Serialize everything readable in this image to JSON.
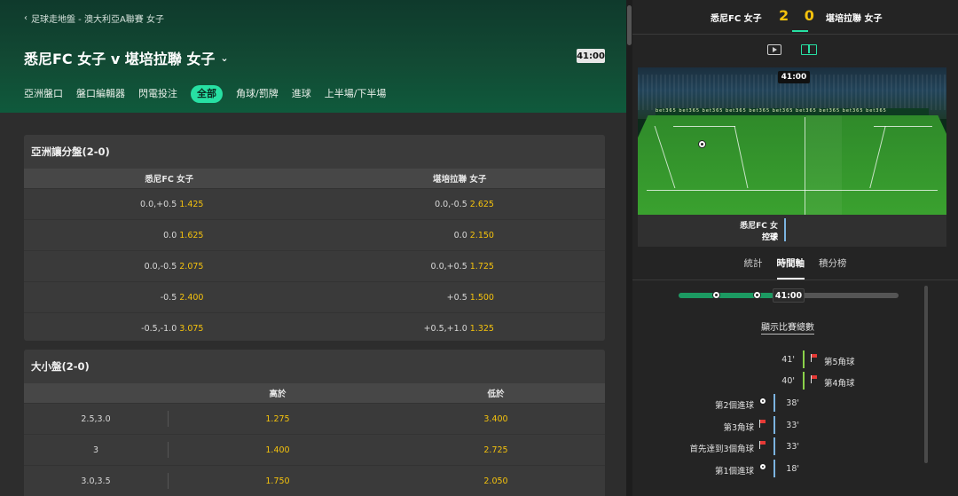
{
  "breadcrumb": "足球走地盤 - 澳大利亞A聯賽 女子",
  "match": {
    "title": "悉尼FC 女子 v 堪培拉聯 女子",
    "clock": "41:00"
  },
  "tabs": [
    "亞洲盤口",
    "盤口編輯器",
    "閃電投注",
    "全部",
    "角球/罰牌",
    "進球",
    "上半場/下半場"
  ],
  "active_tab": "全部",
  "asian_handicap": {
    "title": "亞洲讓分盤(2-0)",
    "home_header": "悉尼FC 女子",
    "away_header": "堪培拉聯 女子",
    "rows": [
      {
        "home_line": "0.0,+0.5",
        "home_price": "1.425",
        "away_line": "0.0,-0.5",
        "away_price": "2.625"
      },
      {
        "home_line": "0.0",
        "home_price": "1.625",
        "away_line": "0.0",
        "away_price": "2.150"
      },
      {
        "home_line": "0.0,-0.5",
        "home_price": "2.075",
        "away_line": "0.0,+0.5",
        "away_price": "1.725"
      },
      {
        "home_line": "-0.5",
        "home_price": "2.400",
        "away_line": "+0.5",
        "away_price": "1.500"
      },
      {
        "home_line": "-0.5,-1.0",
        "home_price": "3.075",
        "away_line": "+0.5,+1.0",
        "away_price": "1.325"
      }
    ]
  },
  "over_under": {
    "title": "大小盤(2-0)",
    "over_header": "高於",
    "under_header": "低於",
    "rows": [
      {
        "line": "2.5,3.0",
        "over": "1.275",
        "under": "3.400"
      },
      {
        "line": "3",
        "over": "1.400",
        "under": "2.725"
      },
      {
        "line": "3.0,3.5",
        "over": "1.750",
        "under": "2.050"
      }
    ]
  },
  "scoreboard": {
    "home": "悉尼FC 女子",
    "score": "2 0",
    "away": "堪培拉聯 女子"
  },
  "pitch": {
    "clock": "41:00",
    "board_text": "bet365 bet365 bet365 bet365 bet365 bet365 bet365 bet365 bet365 bet365",
    "status_team": "悉尼FC 女子",
    "status_action": "控球"
  },
  "right_tabs": [
    "統計",
    "時間軸",
    "積分榜"
  ],
  "active_right_tab": "時間軸",
  "timeline": {
    "clock": "41:00",
    "progress": 0.43,
    "show_total": "顯示比賽總數",
    "events": [
      {
        "minute": "41'",
        "label": "第5角球",
        "side": "away",
        "icon": "corner-flag-icon"
      },
      {
        "minute": "40'",
        "label": "第4角球",
        "side": "away",
        "icon": "corner-flag-icon"
      },
      {
        "minute": "38'",
        "label": "第2個進球",
        "side": "home",
        "icon": "goal-ball-icon"
      },
      {
        "minute": "33'",
        "label": "第3角球",
        "side": "home",
        "icon": "corner-flag-icon"
      },
      {
        "minute": "33'",
        "label": "首先達到3個角球",
        "side": "home",
        "icon": "corner-flag-icon"
      },
      {
        "minute": "18'",
        "label": "第1個進球",
        "side": "home",
        "icon": "goal-ball-icon"
      }
    ]
  },
  "colors": {
    "accent": "#27e0a3",
    "odds": "#f4c20d",
    "home_bar": "#7bb3e0",
    "away_bar": "#8bd14a",
    "corner_flag": "#e53935"
  }
}
